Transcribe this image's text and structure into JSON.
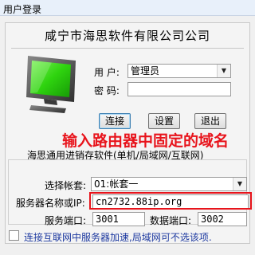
{
  "window": {
    "title": "用户登录"
  },
  "company_name": "咸宁市海思软件有限公司公司",
  "login": {
    "user_label": "用  户:",
    "user_value": "管理员",
    "password_label": "密  码:",
    "password_value": ""
  },
  "buttons": {
    "connect": "连接",
    "settings": "设置",
    "exit": "退出"
  },
  "annotation": "输入路由器中固定的域名",
  "subtitle": "海思通用进销存软件(单机/局域网/互联网)",
  "server": {
    "account_label": "选择帐套:",
    "account_value": "01:帐套一",
    "server_label": "服务器名称或IP:",
    "server_value": "cn2732.88ip.org",
    "server_port_label": "服务端口:",
    "server_port_value": "3001",
    "db_port_label": "数据端口:",
    "db_port_value": "3002"
  },
  "accelerate": {
    "label": "连接互联网中服务器加速,局域网可不选该项.",
    "checked": false
  },
  "colors": {
    "annotation": "#e8141c",
    "highlight_border": "#e8141c",
    "link_text": "#1e3aa0",
    "monitor_screen": "#2fd40f"
  },
  "icons": {
    "monitor": "computer-monitor-icon",
    "dropdown": "chevron-down-icon"
  }
}
